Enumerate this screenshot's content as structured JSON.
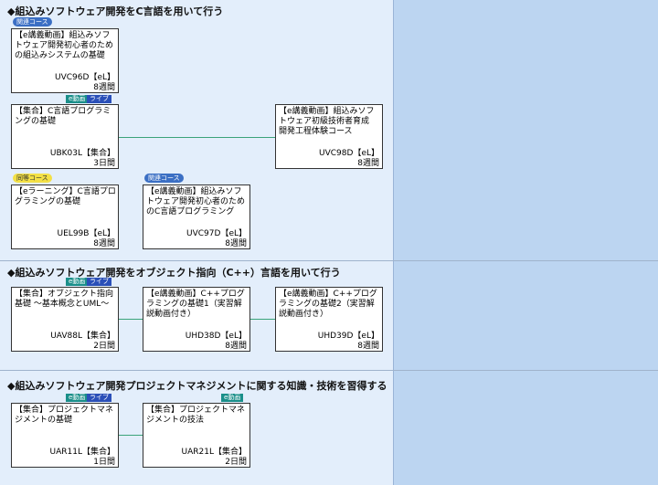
{
  "sections": [
    {
      "heading": "◆組込みソフトウェア開発をC言語を用いて行う"
    },
    {
      "heading": "◆組込みソフトウェア開発をオブジェクト指向（C++）言語を用いて行う"
    },
    {
      "heading": "◆組込みソフトウェア開発プロジェクトマネジメントに関する知識・技術を習得する"
    }
  ],
  "labels": {
    "related": "関連コース",
    "equivalent": "同等コース",
    "e_video": "e動画",
    "live": "ライブ"
  },
  "courses": {
    "uvc96d": {
      "title": "【e講義動画】組込みソフトウェア開発初心者のための組込みシステムの基礎",
      "code": "UVC96D【eL】",
      "duration": "8週間"
    },
    "ubk03l": {
      "title": "【集合】C言語プログラミングの基礎",
      "code": "UBK03L【集合】",
      "duration": "3日間"
    },
    "uvc98d": {
      "title": "【e講義動画】組込みソフトウェア初級技術者育成　開発工程体験コース",
      "code": "UVC98D【eL】",
      "duration": "8週間"
    },
    "uel99b": {
      "title": "【eラーニング】C言語プログラミングの基礎",
      "code": "UEL99B【eL】",
      "duration": "8週間"
    },
    "uvc97d": {
      "title": "【e講義動画】組込みソフトウェア開発初心者のためのC言語プログラミング",
      "code": "UVC97D【eL】",
      "duration": "8週間"
    },
    "uav88l": {
      "title": "【集合】オブジェクト指向基礎 ～基本概念とUML～",
      "code": "UAV88L【集合】",
      "duration": "2日間"
    },
    "uhd38d": {
      "title": "【e講義動画】C++プログラミングの基礎1（実習解説動画付き）",
      "code": "UHD38D【eL】",
      "duration": "8週間"
    },
    "uhd39d": {
      "title": "【e講義動画】C++プログラミングの基礎2（実習解説動画付き）",
      "code": "UHD39D【eL】",
      "duration": "8週間"
    },
    "uar11l": {
      "title": "【集合】プロジェクトマネジメントの基礎",
      "code": "UAR11L【集合】",
      "duration": "1日間"
    },
    "uar21l": {
      "title": "【集合】プロジェクトマネジメントの技法",
      "code": "UAR21L【集合】",
      "duration": "2日間"
    }
  }
}
